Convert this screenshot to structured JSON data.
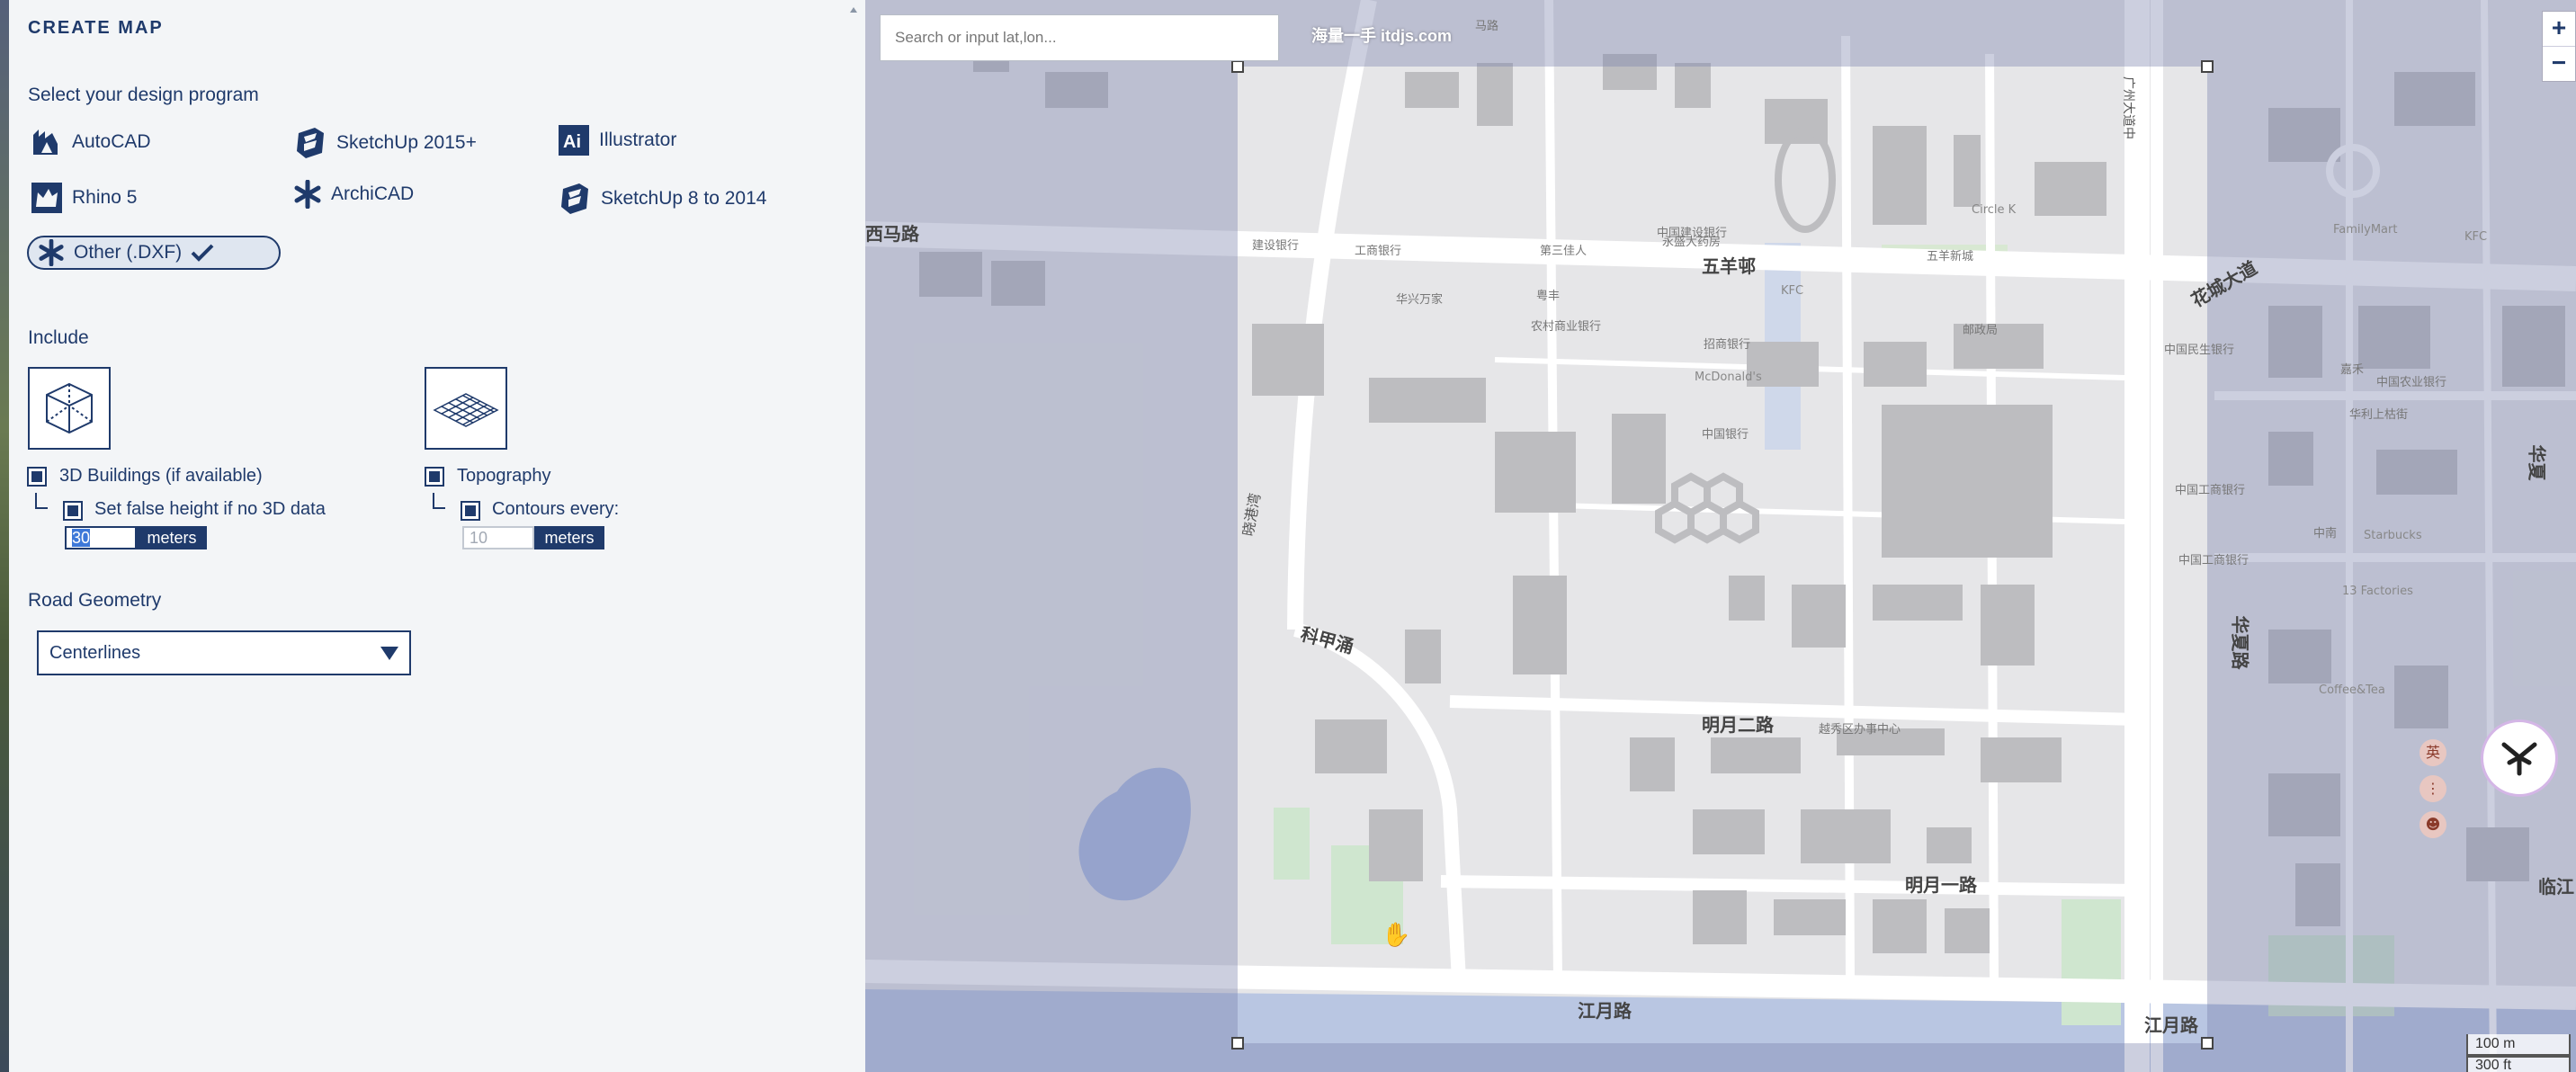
{
  "panel": {
    "title": "CREATE MAP",
    "program_label": "Select your design program",
    "programs": [
      {
        "label": "AutoCAD",
        "icon": "autocad-icon",
        "selected": false
      },
      {
        "label": "SketchUp 2015+",
        "icon": "sketchup-icon",
        "selected": false
      },
      {
        "label": "Illustrator",
        "icon": "illustrator-icon",
        "selected": false
      },
      {
        "label": "Rhino 5",
        "icon": "rhino-icon",
        "selected": false
      },
      {
        "label": "ArchiCAD",
        "icon": "asterisk-icon",
        "selected": false
      },
      {
        "label": "SketchUp 8 to 2014",
        "icon": "sketchup-icon",
        "selected": false
      },
      {
        "label": "Other (.DXF)",
        "icon": "asterisk-icon",
        "selected": true,
        "check_icon": "checkmark-icon"
      }
    ],
    "include_label": "Include",
    "buildings": {
      "label": "3D Buildings (if available)",
      "checked": true,
      "false_height_label": "Set false height if no 3D data",
      "false_height_checked": true,
      "height_value": "30",
      "height_unit": "meters"
    },
    "topography": {
      "label": "Topography",
      "checked": true,
      "contours_label": "Contours every:",
      "contours_checked": true,
      "contour_value": "10",
      "contour_unit": "meters"
    },
    "road_label": "Road Geometry",
    "road_value": "Centerlines"
  },
  "map": {
    "search_placeholder": "Search or input lat,lon...",
    "watermark": "海量一手 itdjs.com",
    "zoom_in": "+",
    "zoom_out": "−",
    "scale_metric": "100 m",
    "scale_imperial": "300 ft",
    "labels": {
      "wuyangyou": "五羊邨",
      "mingyue2": "明月二路",
      "mingyue1": "明月一路",
      "jiangyue": "江月路",
      "jiangyue2": "江月路",
      "kejia": "科甲涌",
      "xiaoye": "晓港湾",
      "huaxia": "华夏路",
      "huaxia2": "华夏",
      "linjiang": "临江",
      "xidi": "西马路",
      "tianhe_ave": "广州大道中",
      "huale": "花城大道",
      "circlek": "Circle K",
      "familymart": "FamilyMart",
      "kfc": "KFC",
      "kfc2": "KFC",
      "mcdonalds": "McDonald's",
      "starbucks": "Starbucks",
      "coffeetea": "Coffee&Tea",
      "factories": "13 Factories",
      "icbc1": "工商银行",
      "icbc2": "中国建设银行",
      "icbc3": "招商银行",
      "icbc4": "中国工商银行",
      "icbc5": "中国工商银行",
      "icbc6": "中国民生银行",
      "bank7": "中国银行",
      "ccb": "建设银行",
      "sanjia": "第三佳人",
      "yongsheng": "永盛大药房",
      "wuyangshi": "五羊新城",
      "huaxinwan": "华兴万家",
      "hualong": "农村商业银行",
      "nongshang": "中国农业银行",
      "yuexiu": "越秀区办事中心",
      "youzheng": "邮政局",
      "huacheng": "华利上枯街",
      "jiahe": "嘉禾",
      "zhongnan": "中南",
      "ma": "马路",
      "yuefeng": "粤丰"
    }
  },
  "colors": {
    "accent": "#1f3a6b",
    "panel_bg": "#f3f5f7",
    "map_bg": "#e4e4e6",
    "overlay": "#7882aa"
  }
}
